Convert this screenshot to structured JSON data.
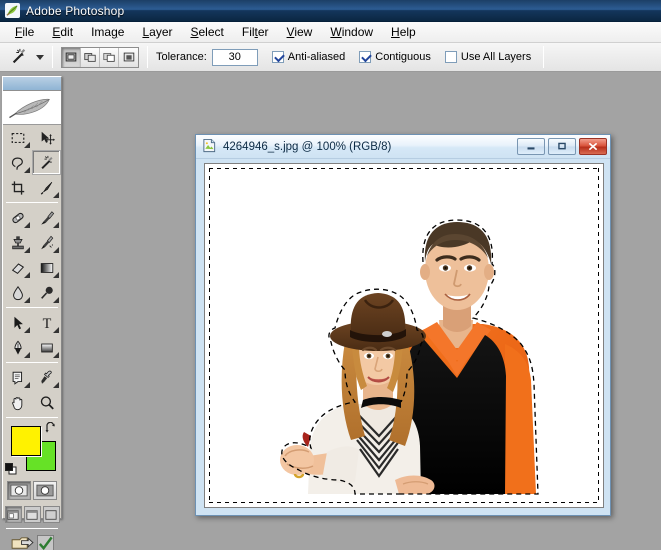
{
  "app": {
    "title": "Adobe Photoshop",
    "icon": "photoshop-feather-icon"
  },
  "menubar": {
    "items": [
      {
        "label": "File",
        "mnemonic": "F"
      },
      {
        "label": "Edit",
        "mnemonic": "E"
      },
      {
        "label": "Image",
        "mnemonic": "g"
      },
      {
        "label": "Layer",
        "mnemonic": "L"
      },
      {
        "label": "Select",
        "mnemonic": "S"
      },
      {
        "label": "Filter",
        "mnemonic": "t"
      },
      {
        "label": "View",
        "mnemonic": "V"
      },
      {
        "label": "Window",
        "mnemonic": "W"
      },
      {
        "label": "Help",
        "mnemonic": "H"
      }
    ]
  },
  "options_bar": {
    "active_tool_icon": "magic-wand-icon",
    "tool_preset_caret": "chevron-down-icon",
    "selection_modes": [
      {
        "name": "new-selection",
        "icon": "new-selection-icon",
        "active": true
      },
      {
        "name": "add-to-selection",
        "icon": "add-to-selection-icon",
        "active": false
      },
      {
        "name": "subtract-from-selection",
        "icon": "subtract-from-selection-icon",
        "active": false
      },
      {
        "name": "intersect-selection",
        "icon": "intersect-selection-icon",
        "active": false
      }
    ],
    "tolerance_label": "Tolerance:",
    "tolerance_value": "30",
    "tolerance_placeholder": "30",
    "checkboxes": [
      {
        "label": "Anti-aliased",
        "checked": true
      },
      {
        "label": "Contiguous",
        "checked": true
      },
      {
        "label": "Use All Layers",
        "checked": false
      }
    ]
  },
  "toolbox": {
    "logo_icon": "photoshop-feather-logo",
    "tools": [
      {
        "name": "rectangular-marquee-tool",
        "icon": "marquee-icon",
        "selected": false,
        "has_flyout": true
      },
      {
        "name": "move-tool",
        "icon": "move-icon",
        "selected": false,
        "has_flyout": false
      },
      {
        "name": "lasso-tool",
        "icon": "lasso-icon",
        "selected": false,
        "has_flyout": true
      },
      {
        "name": "magic-wand-tool",
        "icon": "magic-wand-icon",
        "selected": true,
        "has_flyout": false
      },
      {
        "name": "crop-tool",
        "icon": "crop-icon",
        "selected": false,
        "has_flyout": false
      },
      {
        "name": "slice-tool",
        "icon": "slice-icon",
        "selected": false,
        "has_flyout": true
      },
      {
        "name": "healing-brush-tool",
        "icon": "healing-brush-icon",
        "selected": false,
        "has_flyout": true
      },
      {
        "name": "brush-tool",
        "icon": "brush-icon",
        "selected": false,
        "has_flyout": true
      },
      {
        "name": "clone-stamp-tool",
        "icon": "clone-stamp-icon",
        "selected": false,
        "has_flyout": true
      },
      {
        "name": "history-brush-tool",
        "icon": "history-brush-icon",
        "selected": false,
        "has_flyout": true
      },
      {
        "name": "eraser-tool",
        "icon": "eraser-icon",
        "selected": false,
        "has_flyout": true
      },
      {
        "name": "gradient-tool",
        "icon": "gradient-icon",
        "selected": false,
        "has_flyout": true
      },
      {
        "name": "blur-tool",
        "icon": "blur-drop-icon",
        "selected": false,
        "has_flyout": true
      },
      {
        "name": "dodge-tool",
        "icon": "dodge-icon",
        "selected": false,
        "has_flyout": true
      },
      {
        "name": "path-selection-tool",
        "icon": "path-arrow-icon",
        "selected": false,
        "has_flyout": true
      },
      {
        "name": "type-tool",
        "icon": "type-T-icon",
        "selected": false,
        "has_flyout": true
      },
      {
        "name": "pen-tool",
        "icon": "pen-icon",
        "selected": false,
        "has_flyout": true
      },
      {
        "name": "shape-tool",
        "icon": "shape-rectangle-icon",
        "selected": false,
        "has_flyout": true
      },
      {
        "name": "notes-tool",
        "icon": "notes-icon",
        "selected": false,
        "has_flyout": true
      },
      {
        "name": "eyedropper-tool",
        "icon": "eyedropper-icon",
        "selected": false,
        "has_flyout": true
      },
      {
        "name": "hand-tool",
        "icon": "hand-icon",
        "selected": false,
        "has_flyout": false
      },
      {
        "name": "zoom-tool",
        "icon": "magnifier-icon",
        "selected": false,
        "has_flyout": false
      }
    ],
    "colors": {
      "foreground": "#FFF200",
      "background": "#66E226",
      "swap_icon": "swap-colors-icon",
      "default_icon": "default-colors-icon"
    },
    "quick_mask": [
      {
        "name": "standard-mode",
        "icon": "standard-mode-icon",
        "active": true
      },
      {
        "name": "quick-mask-mode",
        "icon": "quick-mask-icon",
        "active": false
      }
    ],
    "screen_modes": [
      {
        "name": "standard-screen-mode",
        "icon": "standard-screen-icon",
        "active": true
      },
      {
        "name": "full-screen-with-menu",
        "icon": "full-screen-menu-icon",
        "active": false
      },
      {
        "name": "full-screen-mode",
        "icon": "full-screen-icon",
        "active": false
      }
    ],
    "jump_buttons": [
      {
        "name": "jump-to-imageready",
        "icon": "jump-to-imageready-icon"
      },
      {
        "name": "check-mark",
        "icon": "checkmark-icon"
      }
    ]
  },
  "document": {
    "title": "4264946_s.jpg @ 100% (RGB/8)",
    "filename": "4264946_s.jpg",
    "zoom": "100%",
    "color_mode": "RGB/8",
    "icon": "document-thumb-icon",
    "window_buttons": [
      {
        "name": "minimize-button",
        "icon": "minimize-icon"
      },
      {
        "name": "maximize-button",
        "icon": "maximize-icon"
      },
      {
        "name": "close-button",
        "icon": "close-icon"
      }
    ],
    "canvas": {
      "background": "#FFFFFF",
      "selection": "marching-ants-marquee",
      "content_description": "Photograph of a couple: a man in an orange shirt with black vest and a woman in a brown hat and white top, isolated on white background, with an active selection outline."
    }
  }
}
